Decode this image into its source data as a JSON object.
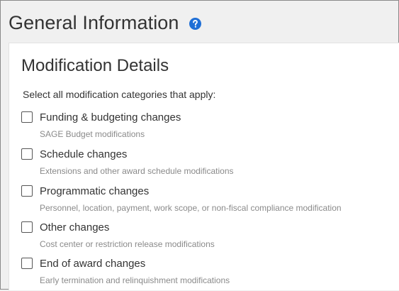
{
  "header": {
    "title": "General Information",
    "help_icon": "question-circle-icon",
    "help_icon_color": "#1f6fd6"
  },
  "card": {
    "section_title": "Modification Details",
    "instruction": "Select all modification categories that apply:",
    "options": [
      {
        "label": "Funding & budgeting changes",
        "description": "SAGE Budget modifications",
        "checked": false
      },
      {
        "label": "Schedule changes",
        "description": "Extensions and other award schedule modifications",
        "checked": false
      },
      {
        "label": "Programmatic changes",
        "description": "Personnel, location, payment, work scope, or non-fiscal compliance modification",
        "checked": false
      },
      {
        "label": "Other changes",
        "description": "Cost center or restriction release modifications",
        "checked": false
      },
      {
        "label": "End of award changes",
        "description": "Early termination and relinquishment modifications",
        "checked": false
      }
    ]
  }
}
